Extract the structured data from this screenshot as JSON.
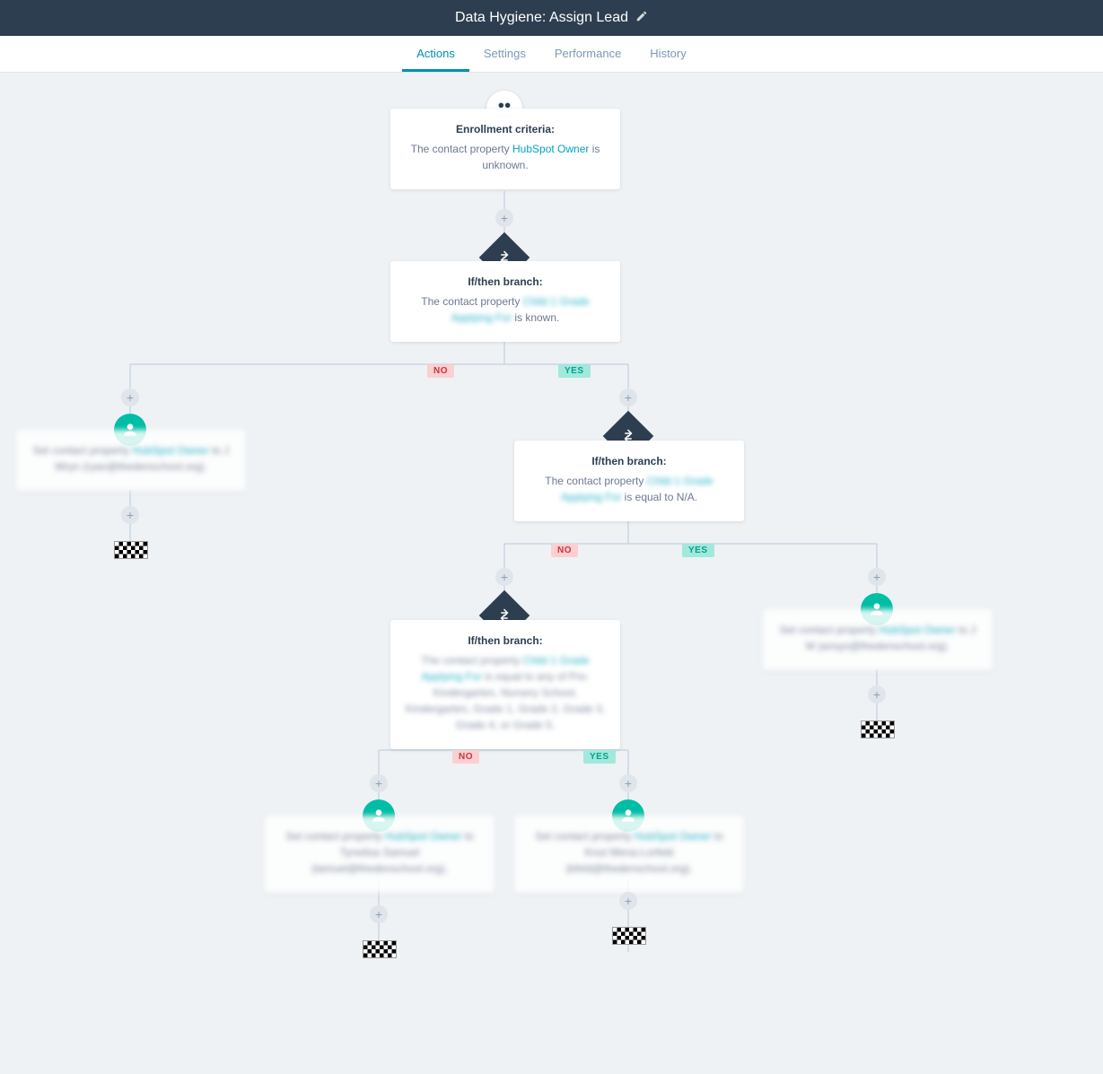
{
  "header": {
    "title": "Data Hygiene: Assign Lead"
  },
  "tabs": {
    "actions": "Actions",
    "settings": "Settings",
    "performance": "Performance",
    "history": "History"
  },
  "labels": {
    "no": "NO",
    "yes": "YES"
  },
  "cards": {
    "enroll": {
      "title": "Enrollment criteria:",
      "pre": "The contact property ",
      "link": "HubSpot Owner",
      "post": " is unknown."
    },
    "branch1": {
      "title": "If/then branch:",
      "pre": "The contact property ",
      "link": "Child 1 Grade Applying For",
      "post": " is known."
    },
    "branch2": {
      "title": "If/then branch:",
      "pre": "The contact property ",
      "link": "Child 1 Grade Applying For",
      "post": " is equal to N/A."
    },
    "branch3": {
      "title": "If/then branch:",
      "pre": "The contact property ",
      "link": "Child 1 Grade Applying For",
      "post2": " is equal to any of Pre-Kindergarten, Nursery School, Kindergarten, Grade 1, Grade 2, Grade 3, Grade 4, or Grade 5."
    },
    "setA": {
      "pre": "Set contact property ",
      "link": "HubSpot Owner",
      "post": " to J Wryn (ryan@thedenschool.org)."
    },
    "setB": {
      "pre": "Set contact property ",
      "link": "HubSpot Owner",
      "post": " to J M (ansys@thedenschool.org)."
    },
    "setC": {
      "pre": "Set contact property ",
      "link": "HubSpot Owner",
      "post": " to Tynetisa Samuel (tamuel@thedenschool.org)."
    },
    "setD": {
      "pre": "Set contact property ",
      "link": "HubSpot Owner",
      "post": " to Knut Mena-Lorfeld (kfeld@thedenschool.org)."
    }
  }
}
